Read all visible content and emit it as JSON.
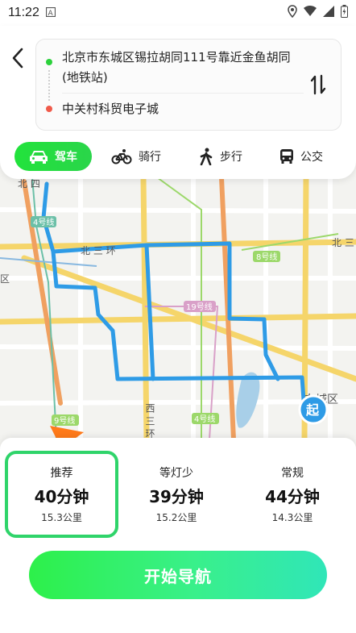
{
  "status_bar": {
    "time": "11:22"
  },
  "trip": {
    "from": "北京市东城区锡拉胡同111号靠近金鱼胡同(地铁站)",
    "to": "中关村科贸电子城"
  },
  "modes": [
    {
      "label": "驾车",
      "icon": "car-icon",
      "active": true
    },
    {
      "label": "骑行",
      "icon": "bicycle-icon",
      "active": false
    },
    {
      "label": "步行",
      "icon": "walking-icon",
      "active": false
    },
    {
      "label": "公交",
      "icon": "bus-icon",
      "active": false
    }
  ],
  "map": {
    "labels": {
      "north_3rd_ring_west": "北 三 环",
      "north_3rd_ring_east": "北 三",
      "line4_top": "4号线",
      "line8": "8号线",
      "line19": "19号线",
      "line4_bottom": "4号线",
      "line9": "9号线",
      "west_3rd_ring": "西 三 环",
      "dongcheng": "东城区",
      "start_marker": "起",
      "top_left_fragment": "北 四",
      "left_fragment": "区"
    },
    "route_color": "#2e9be6"
  },
  "routes": [
    {
      "label": "推荐",
      "time": "40分钟",
      "distance": "15.3公里",
      "selected": true
    },
    {
      "label": "等灯少",
      "time": "39分钟",
      "distance": "15.2公里",
      "selected": false
    },
    {
      "label": "常规",
      "time": "44分钟",
      "distance": "14.3公里",
      "selected": false
    }
  ],
  "actions": {
    "start_navigation": "开始导航"
  },
  "colors": {
    "accent_green": "#22e33c",
    "selected_border": "#2fd46a",
    "origin_dot": "#2bd13b",
    "destination_dot": "#f05a4a"
  }
}
